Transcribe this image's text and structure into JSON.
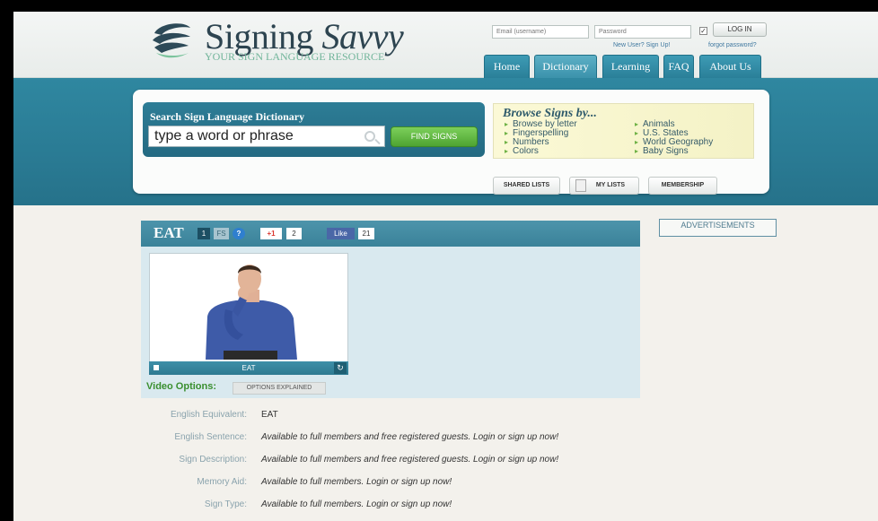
{
  "header": {
    "logo_title_plain": "Signing ",
    "logo_title_italic": "Savvy",
    "logo_tagline": "YOUR SIGN LANGUAGE RESOURCE",
    "email_placeholder": "Email (username)",
    "password_placeholder": "Password",
    "remember_checked": "✓",
    "login_label": "LOG IN",
    "signup_link": "New User? Sign Up!",
    "forgot_link": "forgot password?"
  },
  "nav": {
    "tabs": [
      {
        "label": "Home"
      },
      {
        "label": "Dictionary"
      },
      {
        "label": "Learning"
      },
      {
        "label": "FAQ"
      },
      {
        "label": "About Us"
      }
    ]
  },
  "search": {
    "title": "Search Sign Language Dictionary",
    "input_value": "type a word or phrase",
    "find_label": "FIND SIGNS"
  },
  "browse": {
    "title": "Browse Signs by...",
    "col1": [
      "Browse by letter",
      "Fingerspelling",
      "Numbers",
      "Colors"
    ],
    "col2": [
      "Animals",
      "U.S. States",
      "World Geography",
      "Baby Signs"
    ]
  },
  "panel_buttons": {
    "shared_lists": "SHARED LISTS",
    "my_lists": "MY LISTS",
    "membership": "MEMBERSHIP"
  },
  "sign": {
    "word": "EAT",
    "variant_number": "1",
    "fs_label": "FS",
    "help_label": "?",
    "gplus_label": "+1",
    "gplus_count": "2",
    "like_label": "Like",
    "like_count": "21",
    "video_caption": "EAT",
    "video_options_label": "Video Options:",
    "options_explained": "OPTIONS EXPLAINED"
  },
  "ads_label": "ADVERTISEMENTS",
  "details": [
    {
      "label": "English Equivalent:",
      "value": "EAT"
    },
    {
      "label": "English Sentence:",
      "value": "Available to full members and free registered guests. Login or sign up now!"
    },
    {
      "label": "Sign Description:",
      "value": "Available to full members and free registered guests. Login or sign up now!"
    },
    {
      "label": "Memory Aid:",
      "value": "Available to full members. Login or sign up now!"
    },
    {
      "label": "Sign Type:",
      "value": "Available to full members. Login or sign up now!"
    }
  ],
  "colors": {
    "brand_teal": "#2a7f98",
    "brand_green": "#4ea432",
    "logo_dark": "#2d4450"
  }
}
